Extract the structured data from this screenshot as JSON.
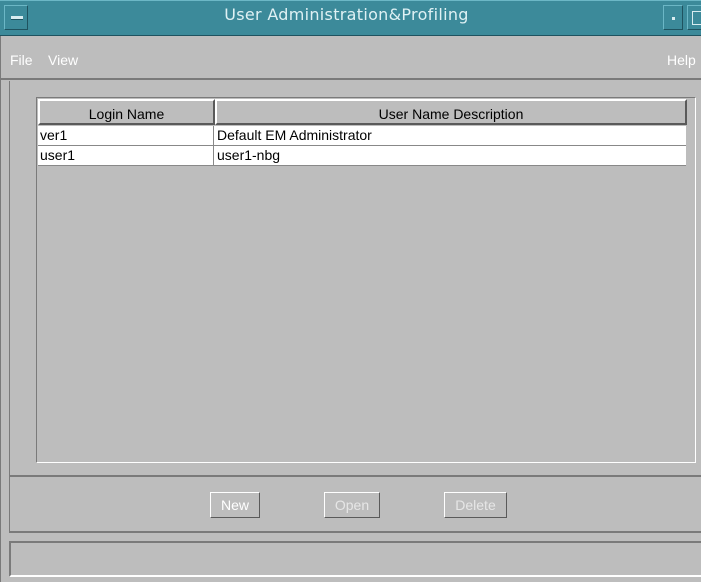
{
  "window": {
    "title": "User Administration&Profiling"
  },
  "menubar": {
    "items": [
      "File",
      "View"
    ],
    "help": "Help"
  },
  "table": {
    "columns": [
      "Login Name",
      "User Name Description"
    ],
    "rows": [
      {
        "login": "ver1",
        "description": "Default EM Administrator"
      },
      {
        "login": "user1",
        "description": "user1-nbg"
      }
    ]
  },
  "buttons": {
    "new_label": "New",
    "open_label": "Open",
    "delete_label": "Delete"
  },
  "status": {
    "text": ""
  },
  "colors": {
    "titlebar": "#3c8a9a",
    "background": "#bdbdbd",
    "menu_text": "#ffffff"
  },
  "icons": [
    "window-menu-icon",
    "minimize-icon",
    "maximize-icon"
  ]
}
